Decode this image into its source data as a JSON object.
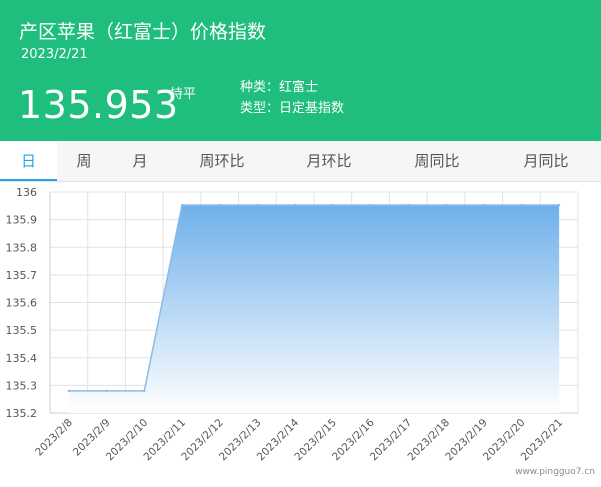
{
  "header": {
    "title": "产区苹果（红富士）价格指数",
    "date": "2023/2/21",
    "value": "135.953",
    "trend": "持平",
    "variety": "种类：红富士",
    "index_type": "类型：日定基指数"
  },
  "tabs": [
    {
      "label": "日",
      "active": true
    },
    {
      "label": "周",
      "active": false
    },
    {
      "label": "月",
      "active": false
    },
    {
      "label": "周环比",
      "active": false
    },
    {
      "label": "月环比",
      "active": false
    },
    {
      "label": "周同比",
      "active": false
    },
    {
      "label": "月同比",
      "active": false
    }
  ],
  "colors": {
    "header_bg": "#1fbe7c",
    "accent": "#1fa8e6",
    "series_line": "#8dbbe8",
    "fill_top": "#6fb0ea",
    "fill_bottom": "#ffffff"
  },
  "chart_data": {
    "type": "area",
    "x": [
      "2023/2/8",
      "2023/2/9",
      "2023/2/10",
      "2023/2/11",
      "2023/2/12",
      "2023/2/13",
      "2023/2/14",
      "2023/2/15",
      "2023/2/16",
      "2023/2/17",
      "2023/2/18",
      "2023/2/19",
      "2023/2/20",
      "2023/2/21"
    ],
    "values": [
      135.28,
      135.28,
      135.28,
      135.953,
      135.953,
      135.953,
      135.953,
      135.953,
      135.953,
      135.953,
      135.953,
      135.953,
      135.953,
      135.953
    ],
    "yticks": [
      "135.2",
      "135.3",
      "135.4",
      "135.5",
      "135.6",
      "135.7",
      "135.8",
      "135.9",
      "136"
    ],
    "ylim": [
      135.2,
      136
    ],
    "grid": true
  },
  "watermark": "www.pingguo7.cn"
}
